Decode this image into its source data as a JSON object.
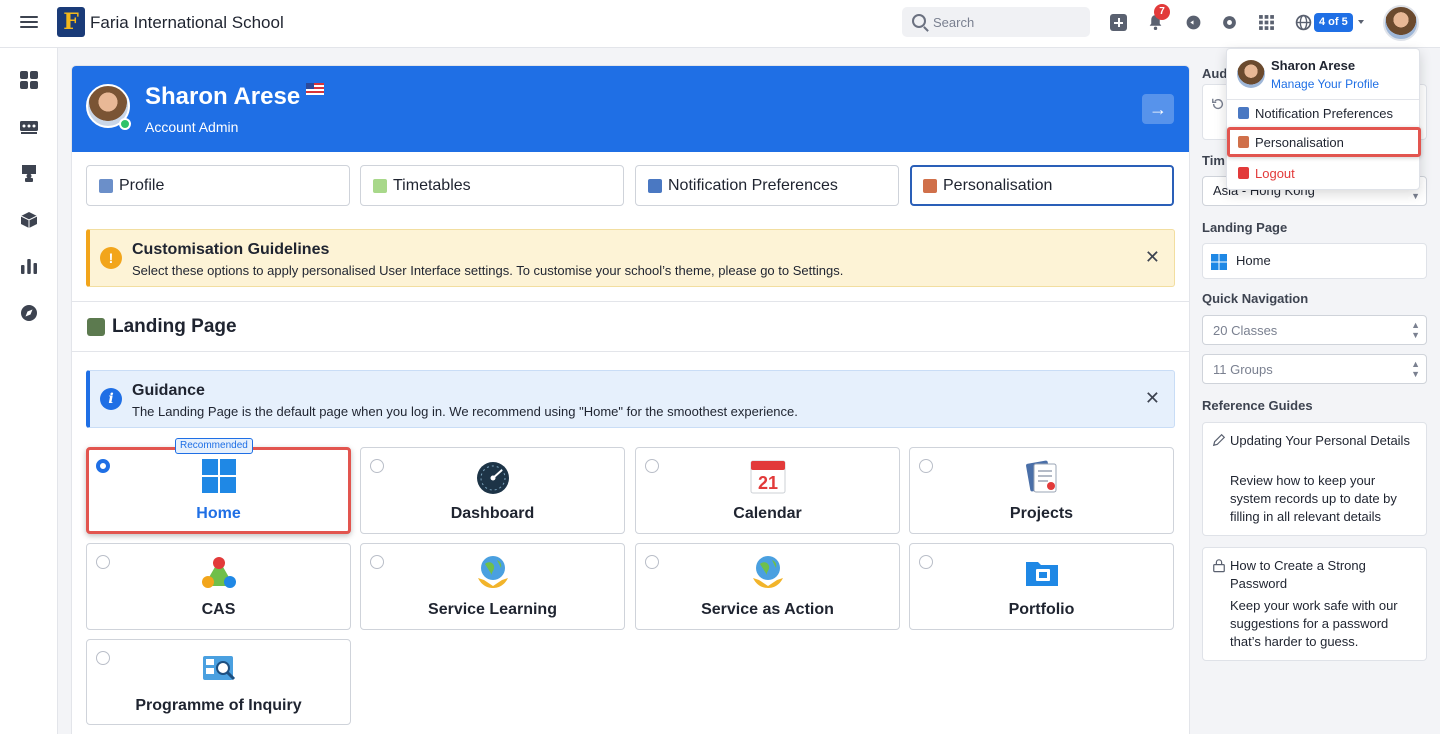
{
  "topbar": {
    "school_name": "Faria International School",
    "logo_letter": "F",
    "search_placeholder": "Search",
    "notification_count": "7",
    "counter": "4 of 5"
  },
  "profile": {
    "name": "Sharon Arese",
    "role": "Account Admin"
  },
  "tabs": [
    {
      "label": "Profile",
      "color": "#6b8fc9"
    },
    {
      "label": "Timetables",
      "color": "#a8d88a"
    },
    {
      "label": "Notification Preferences",
      "color": "#4a78c2"
    },
    {
      "label": "Personalisation",
      "color": "#d0704a"
    }
  ],
  "customisation_alert": {
    "title": "Customisation Guidelines",
    "body": "Select these options to apply personalised User Interface settings. To customise your school’s theme, please go to Settings.",
    "icon": "!"
  },
  "landing_section": {
    "title": "Landing Page"
  },
  "guidance_alert": {
    "title": "Guidance",
    "body": "The Landing Page is the default page when you log in. We recommend using \"Home\" for the smoothest experience.",
    "icon": "i"
  },
  "recommended_label": "Recommended",
  "landing_options": [
    {
      "label": "Home",
      "selected": true
    },
    {
      "label": "Dashboard",
      "selected": false
    },
    {
      "label": "Calendar",
      "selected": false
    },
    {
      "label": "Projects",
      "selected": false
    },
    {
      "label": "CAS",
      "selected": false
    },
    {
      "label": "Service Learning",
      "selected": false
    },
    {
      "label": "Service as Action",
      "selected": false
    },
    {
      "label": "Portfolio",
      "selected": false
    },
    {
      "label": "Programme of Inquiry",
      "selected": false
    }
  ],
  "calendar_day": "21",
  "right_panel": {
    "audit_label": "Aud",
    "timezone_label": "Tim",
    "timezone_value": "Asia - Hong Kong",
    "landing_label": "Landing Page",
    "landing_value": "Home",
    "quicknav_label": "Quick Navigation",
    "quicknav_classes": "20 Classes",
    "quicknav_groups": "11 Groups",
    "guides_label": "Reference Guides",
    "guides": [
      {
        "title": "Updating Your Personal Details",
        "body": "Review how to keep your system records up to date by filling in all relevant details"
      },
      {
        "title": "How to Create a Strong Password",
        "body": "Keep your work safe with our suggestions for a password that’s harder to guess."
      }
    ]
  },
  "user_menu": {
    "name": "Sharon Arese",
    "manage": "Manage Your Profile",
    "items": [
      "Notification Preferences",
      "Personalisation",
      "Logout"
    ]
  },
  "colors": {
    "primary": "#1f6fe5",
    "highlight": "#e2554f",
    "warning": "#f2a51b",
    "danger": "#e23a3a"
  }
}
